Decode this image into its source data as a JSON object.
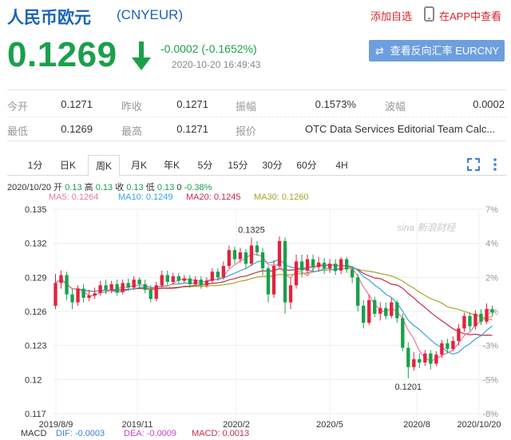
{
  "header": {
    "title": "人民币欧元",
    "code": "(CNYEUR)",
    "add_favorite": "添加自选",
    "app_link": "在APP中查看"
  },
  "quote": {
    "price": "0.1269",
    "change": "-0.0002 (-0.1652%)",
    "time": "2020-10-20 16:49:43",
    "reverse_button": "查看反向汇率 EURCNY",
    "color_down": "#1aa04b"
  },
  "stats": [
    {
      "label": "今开",
      "value": "0.1271"
    },
    {
      "label": "昨收",
      "value": "0.1271"
    },
    {
      "label": "振幅",
      "value": "0.1573%"
    },
    {
      "label": "波幅",
      "value": "0.0002"
    },
    {
      "label": "最低",
      "value": "0.1269"
    },
    {
      "label": "最高",
      "value": "0.1271"
    },
    {
      "label": "报价",
      "value": "OTC Data Services Editorial Team Calc..."
    }
  ],
  "tabs": [
    "1分",
    "日K",
    "周K",
    "月K",
    "年K",
    "5分",
    "15分",
    "30分",
    "60分",
    "4H"
  ],
  "active_tab": "周K",
  "info": {
    "date": "2020/10/20",
    "open_label": "开",
    "open_value": "0.13",
    "high_label": "高",
    "high_value": "0.13",
    "close_label": "收",
    "close_value": "0.13",
    "low_label": "低",
    "low_value": "0.13",
    "change_value": "0",
    "pct_value": "-0.38%"
  },
  "ma": {
    "ma5": "MA5: 0.1264",
    "ma10": "MA10: 0.1249",
    "ma20": "MA20: 0.1245",
    "ma30": "MA30: 0.1260",
    "ma5_color": "#e8799b",
    "ma10_color": "#3aa5dc",
    "ma20_color": "#c0304a",
    "ma30_color": "#a7a52a"
  },
  "macd": {
    "label": "MACD",
    "dif": "DIF: -0.0003",
    "dea": "DEA: -0.0009",
    "macd": "MACD: 0.0013"
  },
  "watermark": "sina 新浪财经",
  "chart_data": {
    "type": "candlestick",
    "title": "",
    "y_ticks": [
      "0.135",
      "0.132",
      "0.129",
      "0.126",
      "0.123",
      "0.12",
      "0.117"
    ],
    "y2_ticks": [
      "7%",
      "4%",
      "2%",
      "0%",
      "-3%",
      "-5%",
      "-8%"
    ],
    "ylim": [
      0.117,
      0.135
    ],
    "x_labels": [
      "2019/8/9",
      "2019/11",
      "2020/2",
      "2020/5",
      "2020/8",
      "2020/10/20"
    ],
    "annotations": [
      {
        "text": "0.1325",
        "index": 35,
        "value": 0.1325
      },
      {
        "text": "0.1201",
        "index": 63,
        "value": 0.1201
      }
    ],
    "candles": [
      [
        0.1265,
        0.1285,
        0.1293,
        0.1262
      ],
      [
        0.1285,
        0.1292,
        0.1296,
        0.128
      ],
      [
        0.1292,
        0.1275,
        0.1295,
        0.127
      ],
      [
        0.1275,
        0.1268,
        0.128,
        0.1262
      ],
      [
        0.1268,
        0.128,
        0.1283,
        0.1265
      ],
      [
        0.128,
        0.1272,
        0.1284,
        0.1268
      ],
      [
        0.1272,
        0.1274,
        0.1279,
        0.1269
      ],
      [
        0.1274,
        0.1276,
        0.1281,
        0.1271
      ],
      [
        0.1276,
        0.1283,
        0.1287,
        0.1274
      ],
      [
        0.1283,
        0.1279,
        0.1288,
        0.1275
      ],
      [
        0.1279,
        0.1284,
        0.1287,
        0.1276
      ],
      [
        0.1284,
        0.1277,
        0.1288,
        0.1274
      ],
      [
        0.1277,
        0.1285,
        0.1288,
        0.1275
      ],
      [
        0.1285,
        0.1281,
        0.1289,
        0.1278
      ],
      [
        0.1281,
        0.1288,
        0.1291,
        0.1279
      ],
      [
        0.1288,
        0.1284,
        0.129,
        0.128
      ],
      [
        0.1284,
        0.1279,
        0.1288,
        0.1276
      ],
      [
        0.1279,
        0.1271,
        0.1283,
        0.1268
      ],
      [
        0.1271,
        0.1283,
        0.1286,
        0.1269
      ],
      [
        0.1283,
        0.1292,
        0.1296,
        0.1281
      ],
      [
        0.1292,
        0.1286,
        0.1296,
        0.1283
      ],
      [
        0.1286,
        0.1291,
        0.1294,
        0.1284
      ],
      [
        0.1291,
        0.1287,
        0.1294,
        0.1284
      ],
      [
        0.1287,
        0.1289,
        0.1292,
        0.1285
      ],
      [
        0.1289,
        0.1284,
        0.1292,
        0.1281
      ],
      [
        0.1284,
        0.1288,
        0.1291,
        0.1282
      ],
      [
        0.1288,
        0.1283,
        0.1291,
        0.128
      ],
      [
        0.1283,
        0.1287,
        0.129,
        0.1281
      ],
      [
        0.1287,
        0.1295,
        0.1298,
        0.1285
      ],
      [
        0.1295,
        0.129,
        0.1298,
        0.1287
      ],
      [
        0.129,
        0.13,
        0.1304,
        0.1288
      ],
      [
        0.13,
        0.1314,
        0.1318,
        0.1298
      ],
      [
        0.1314,
        0.1306,
        0.1317,
        0.1302
      ],
      [
        0.1306,
        0.1312,
        0.1316,
        0.1303
      ],
      [
        0.1312,
        0.1302,
        0.1315,
        0.1298
      ],
      [
        0.1302,
        0.1318,
        0.1325,
        0.13
      ],
      [
        0.1318,
        0.1312,
        0.1322,
        0.1309
      ],
      [
        0.1312,
        0.1298,
        0.1316,
        0.1292
      ],
      [
        0.1298,
        0.1275,
        0.13,
        0.1268
      ],
      [
        0.1275,
        0.13,
        0.1305,
        0.1272
      ],
      [
        0.13,
        0.1322,
        0.1326,
        0.1298
      ],
      [
        0.1322,
        0.1268,
        0.1325,
        0.1258
      ],
      [
        0.1268,
        0.1283,
        0.129,
        0.1262
      ],
      [
        0.1283,
        0.1304,
        0.131,
        0.128
      ],
      [
        0.1304,
        0.1296,
        0.131,
        0.129
      ],
      [
        0.1296,
        0.1306,
        0.131,
        0.1293
      ],
      [
        0.1306,
        0.1299,
        0.131,
        0.1295
      ],
      [
        0.1299,
        0.1303,
        0.1308,
        0.1295
      ],
      [
        0.1303,
        0.1298,
        0.1307,
        0.1293
      ],
      [
        0.1298,
        0.1302,
        0.1306,
        0.1294
      ],
      [
        0.1302,
        0.1296,
        0.1306,
        0.1292
      ],
      [
        0.1296,
        0.1306,
        0.1308,
        0.1293
      ],
      [
        0.1306,
        0.1297,
        0.1308,
        0.1294
      ],
      [
        0.1297,
        0.129,
        0.13,
        0.1285
      ],
      [
        0.129,
        0.1265,
        0.1293,
        0.126
      ],
      [
        0.1265,
        0.125,
        0.127,
        0.1245
      ],
      [
        0.125,
        0.127,
        0.1275,
        0.1248
      ],
      [
        0.127,
        0.1258,
        0.1273,
        0.1255
      ],
      [
        0.1258,
        0.1263,
        0.1268,
        0.1252
      ],
      [
        0.1263,
        0.1256,
        0.1268,
        0.1253
      ],
      [
        0.1256,
        0.1268,
        0.1272,
        0.1254
      ],
      [
        0.1268,
        0.1254,
        0.127,
        0.125
      ],
      [
        0.1254,
        0.1228,
        0.1258,
        0.1225
      ],
      [
        0.1228,
        0.1211,
        0.1233,
        0.1201
      ],
      [
        0.1211,
        0.1218,
        0.1224,
        0.1208
      ],
      [
        0.1218,
        0.1215,
        0.1223,
        0.121
      ],
      [
        0.1215,
        0.1223,
        0.1226,
        0.1212
      ],
      [
        0.1223,
        0.1214,
        0.1226,
        0.1209
      ],
      [
        0.1214,
        0.1222,
        0.1225,
        0.1212
      ],
      [
        0.1222,
        0.1232,
        0.1235,
        0.1219
      ],
      [
        0.1232,
        0.1227,
        0.1236,
        0.1223
      ],
      [
        0.1227,
        0.1234,
        0.1238,
        0.1225
      ],
      [
        0.1234,
        0.1245,
        0.1249,
        0.123
      ],
      [
        0.1245,
        0.1256,
        0.1259,
        0.1242
      ],
      [
        0.1256,
        0.1247,
        0.1259,
        0.1243
      ],
      [
        0.1247,
        0.1258,
        0.1261,
        0.1244
      ],
      [
        0.1258,
        0.1251,
        0.1262,
        0.1248
      ],
      [
        0.1251,
        0.1262,
        0.1267,
        0.1249
      ],
      [
        0.1262,
        0.1259,
        0.1265,
        0.1256
      ]
    ]
  }
}
